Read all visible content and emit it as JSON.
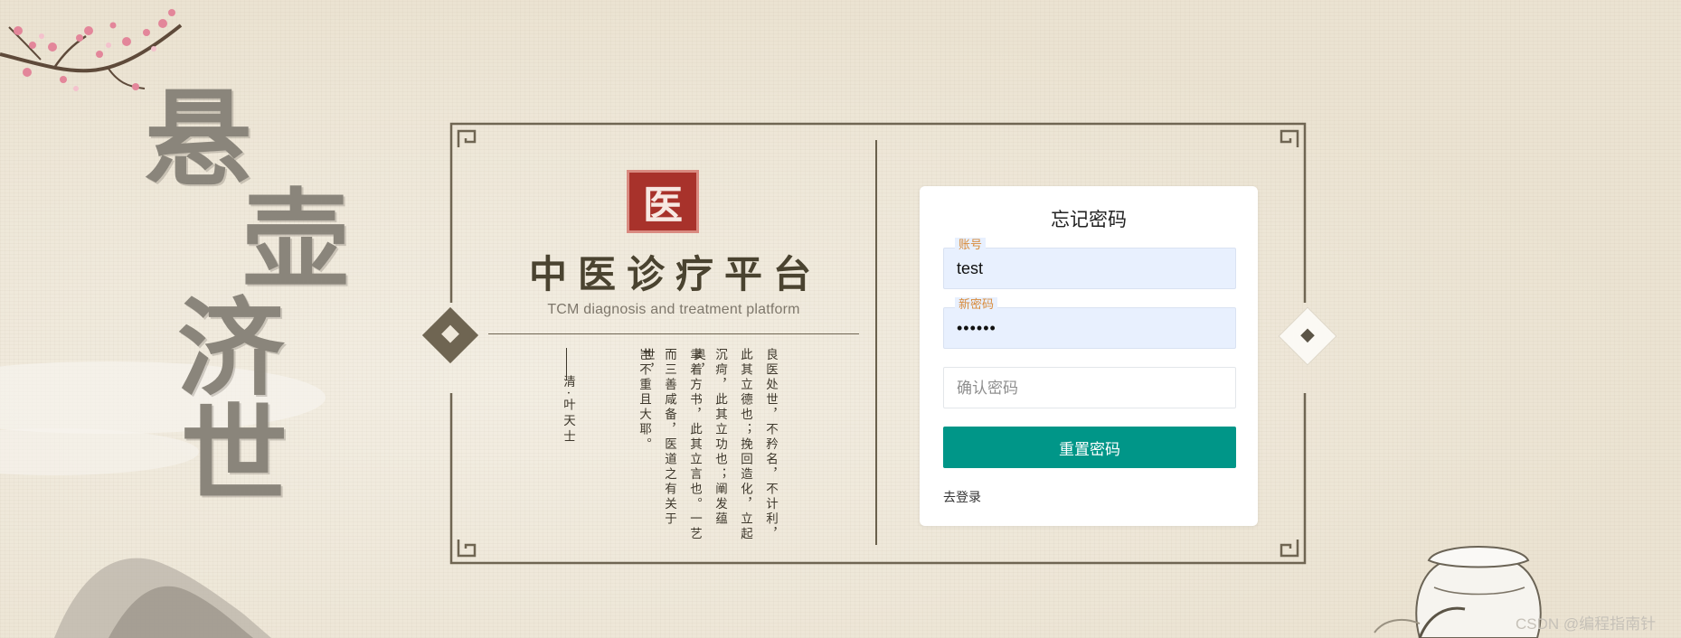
{
  "decor": {
    "big_calligraphy": [
      "悬",
      "壶",
      "济",
      "世"
    ],
    "seal_char": "医"
  },
  "platform": {
    "title": "中医诊疗平台",
    "subtitle": "TCM diagnosis and treatment platform"
  },
  "poem": {
    "columns": [
      "良医处世，不矜名，不计利，",
      "此其立德也；挽回造化，立起",
      "沉疴，此其立功也；阐发蕴奥，",
      "聿着方书，此其立言也。一艺",
      "而三善咸备，医道之有关于世，",
      "岂不重且大耶。"
    ],
    "signature": "清·叶天士"
  },
  "form": {
    "title": "忘记密码",
    "account_label": "账号",
    "account_value": "test",
    "new_password_label": "新密码",
    "new_password_value": "••••••",
    "confirm_placeholder": "确认密码",
    "submit_label": "重置密码",
    "login_link": "去登录"
  },
  "watermark": "CSDN @编程指南针",
  "colors": {
    "primary_button": "#009688",
    "label_orange": "#d88b3b",
    "seal_red": "#a8322b",
    "frame_brown": "#6f6552"
  }
}
